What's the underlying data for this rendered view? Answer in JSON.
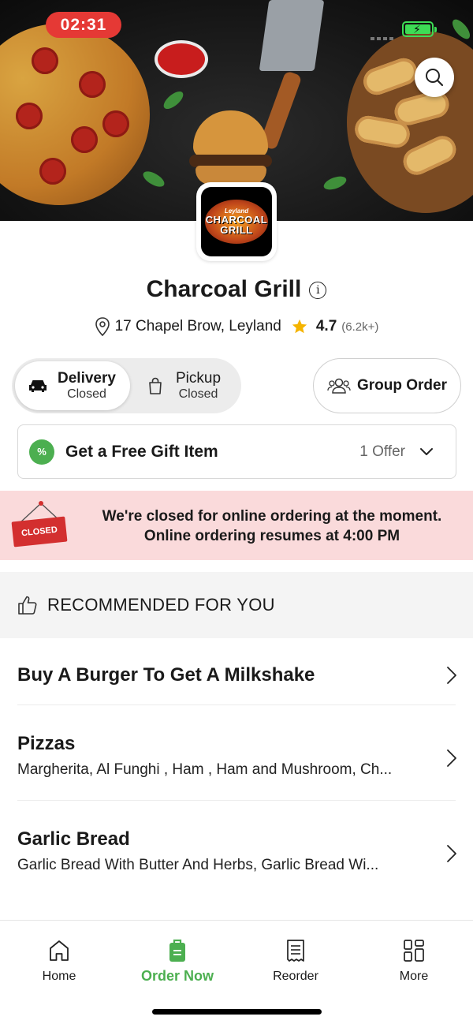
{
  "status_bar": {
    "time": "02:31"
  },
  "restaurant": {
    "name": "Charcoal Grill",
    "address": "17 Chapel Brow, Leyland",
    "rating": "4.7",
    "rating_count": "(6.2k+)",
    "logo": {
      "top": "Leyland",
      "line1": "CHARCOAL",
      "line2": "GRILL"
    }
  },
  "order_modes": {
    "delivery": {
      "label": "Delivery",
      "status": "Closed"
    },
    "pickup": {
      "label": "Pickup",
      "status": "Closed"
    },
    "group_order": "Group Order"
  },
  "offer": {
    "title": "Get a Free Gift Item",
    "count": "1 Offer",
    "badge": "%"
  },
  "closed_banner": {
    "sign": "CLOSED",
    "line1": "We're closed for online ordering at the moment.",
    "line2": "Online ordering resumes at 4:00 PM"
  },
  "recommended": {
    "title": "RECOMMENDED FOR YOU"
  },
  "categories": [
    {
      "title": "Buy A Burger To Get A Milkshake",
      "subtitle": ""
    },
    {
      "title": "Pizzas",
      "subtitle": "Margherita, Al Funghi , Ham , Ham and Mushroom, Ch..."
    },
    {
      "title": "Garlic Bread",
      "subtitle": "Garlic Bread With Butter And Herbs, Garlic Bread Wi..."
    }
  ],
  "bottom_nav": [
    {
      "label": "Home",
      "icon": "home-icon"
    },
    {
      "label": "Order Now",
      "icon": "order-bag-icon",
      "active": true
    },
    {
      "label": "Reorder",
      "icon": "receipt-icon"
    },
    {
      "label": "More",
      "icon": "grid-icon"
    }
  ],
  "colors": {
    "accent": "#4caf50",
    "closed_banner_bg": "#fadadb",
    "status_time_bg": "#e53935",
    "rating_star": "#f5b400"
  }
}
